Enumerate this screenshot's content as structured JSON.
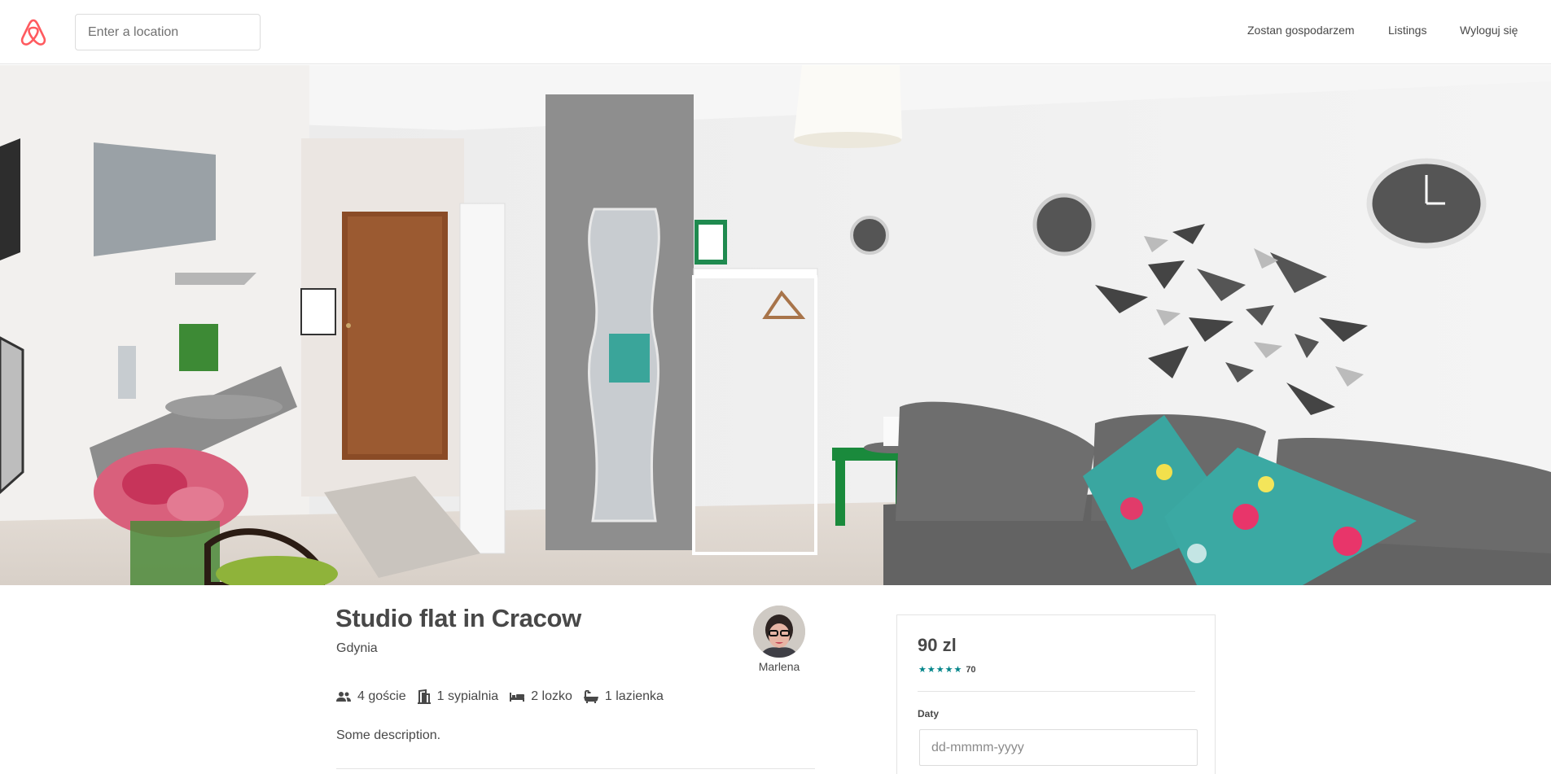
{
  "header": {
    "search_placeholder": "Enter a location",
    "nav": {
      "host": "Zostan gospodarzem",
      "listings": "Listings",
      "logout": "Wyloguj się"
    }
  },
  "listing": {
    "title": "Studio flat in Cracow",
    "city": "Gdynia",
    "host_name": "Marlena",
    "amenities": {
      "guests": "4 goście",
      "bedrooms": "1 sypialnia",
      "beds": "2 lozko",
      "bathrooms": "1 lazienka"
    },
    "description": "Some description."
  },
  "booking": {
    "price": "90 zl",
    "stars": "★★★★★",
    "review_count": "70",
    "dates_label": "Daty",
    "date_placeholder": "dd-mmmm-yyyy"
  },
  "colors": {
    "brand": "#ff5a5f",
    "star": "#008489",
    "text": "#484848"
  }
}
